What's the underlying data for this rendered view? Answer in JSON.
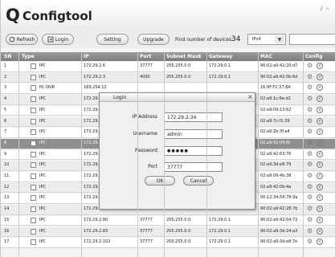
{
  "app": {
    "logo_letter": "Q",
    "logo_text": "Configtool",
    "info_glyph": "i",
    "minimize_glyph": "–"
  },
  "toolbar": {
    "refresh_label": "Refresh",
    "login_label": "Login",
    "setting_label": "Setting",
    "upgrade_label": "Upgrade",
    "found_label": "Find number of devices:",
    "found_count": "34",
    "version_select": "IPv4",
    "search_value": ""
  },
  "columns": [
    "SN",
    "Type",
    "IP",
    "Port",
    "Subnet Mask",
    "Gateway",
    "MAC",
    "Config"
  ],
  "rows": [
    {
      "sn": "1",
      "type": "IPC",
      "ip": "172.29.2.6",
      "port": "37777",
      "mask": "255.255.0.0",
      "gateway": "172.29.0.1",
      "mac": "90:02:a9:42:20:d7"
    },
    {
      "sn": "2",
      "type": "IPC",
      "ip": "172.29.2.3",
      "port": "4000",
      "mask": "255.255.0.0",
      "gateway": "172.29.0.1",
      "mac": "90:02:a9:42:0b:6d"
    },
    {
      "sn": "3",
      "type": "PC-NVR",
      "ip": "169.254.12",
      "port": "",
      "mask": "",
      "gateway": "",
      "mac": "16:9F:F2:37:8A"
    },
    {
      "sn": "4",
      "type": "IPC",
      "ip": "172.29.2.8",
      "port": "",
      "mask": "",
      "gateway": "",
      "mac": "02:a9:1c:6e:d2"
    },
    {
      "sn": "5",
      "type": "IPC",
      "ip": "172.29.2.5",
      "port": "",
      "mask": "",
      "gateway": "",
      "mac": "02:a9:09:13:62"
    },
    {
      "sn": "6",
      "type": "IPC",
      "ip": "172.29.2.7",
      "port": "",
      "mask": "",
      "gateway": "",
      "mac": "02:a9:7c:f1:39"
    },
    {
      "sn": "7",
      "type": "IPC",
      "ip": "172.29.2.4",
      "port": "",
      "mask": "",
      "gateway": "",
      "mac": "02:a9:2b:3f:a4"
    },
    {
      "sn": "8",
      "type": "IPC",
      "ip": "172.29.2.34",
      "port": "",
      "mask": "",
      "gateway": "",
      "mac": "02:a9:42:04:6f"
    },
    {
      "sn": "9",
      "type": "IPC",
      "ip": "172.29.2.40",
      "port": "",
      "mask": "",
      "gateway": "",
      "mac": "02:a9:42:63:76"
    },
    {
      "sn": "10",
      "type": "IPC",
      "ip": "172.29.2.4",
      "port": "",
      "mask": "",
      "gateway": "",
      "mac": "02:a9:3d:e8:79"
    },
    {
      "sn": "11",
      "type": "IPC",
      "ip": "172.29.2.3",
      "port": "",
      "mask": "",
      "gateway": "",
      "mac": "02:a9:09:4b:38"
    },
    {
      "sn": "12",
      "type": "IPC",
      "ip": "172.29.2.61",
      "port": "",
      "mask": "",
      "gateway": "",
      "mac": "02:a9:42:0b:4a"
    },
    {
      "sn": "13",
      "type": "IPC",
      "ip": "172.29.2.38",
      "port": "37777",
      "mask": "255.255.0.0",
      "gateway": "172.29.0.1",
      "mac": "00:12:34:56:78:9a"
    },
    {
      "sn": "14",
      "type": "IPC",
      "ip": "172.29.2.47",
      "port": "37777",
      "mask": "255.255.0.0",
      "gateway": "172.29.0.1",
      "mac": "90:02:a9:42:28:7b"
    },
    {
      "sn": "15",
      "type": "IPC",
      "ip": "172.29.2.80",
      "port": "37777",
      "mask": "255.255.0.0",
      "gateway": "172.29.0.1",
      "mac": "90:02:a9:42:04:72"
    },
    {
      "sn": "16",
      "type": "IPC",
      "ip": "172.29.2.83",
      "port": "37777",
      "mask": "255.255.0.0",
      "gateway": "172.29.0.1",
      "mac": "90:02:a9:3d:24:a3"
    },
    {
      "sn": "17",
      "type": "IPC",
      "ip": "172.29.2.102",
      "port": "37777",
      "mask": "255.255.0.0",
      "gateway": "172.29.0.1",
      "mac": "90:02:a9:3d:e8:7e"
    }
  ],
  "selected_row": 8,
  "config_icons": {
    "gear": "⚙",
    "web": "e"
  },
  "dialog": {
    "title": "Login",
    "close_glyph": "×",
    "ip_label": "IP Address",
    "ip_value": "172.29.2.34",
    "user_label": "Username",
    "user_value": "admin",
    "pass_label": "Password",
    "pass_value": "●●●●●",
    "port_label": "Port",
    "port_value": "37777",
    "ok_label": "OK",
    "cancel_label": "Cancel"
  }
}
